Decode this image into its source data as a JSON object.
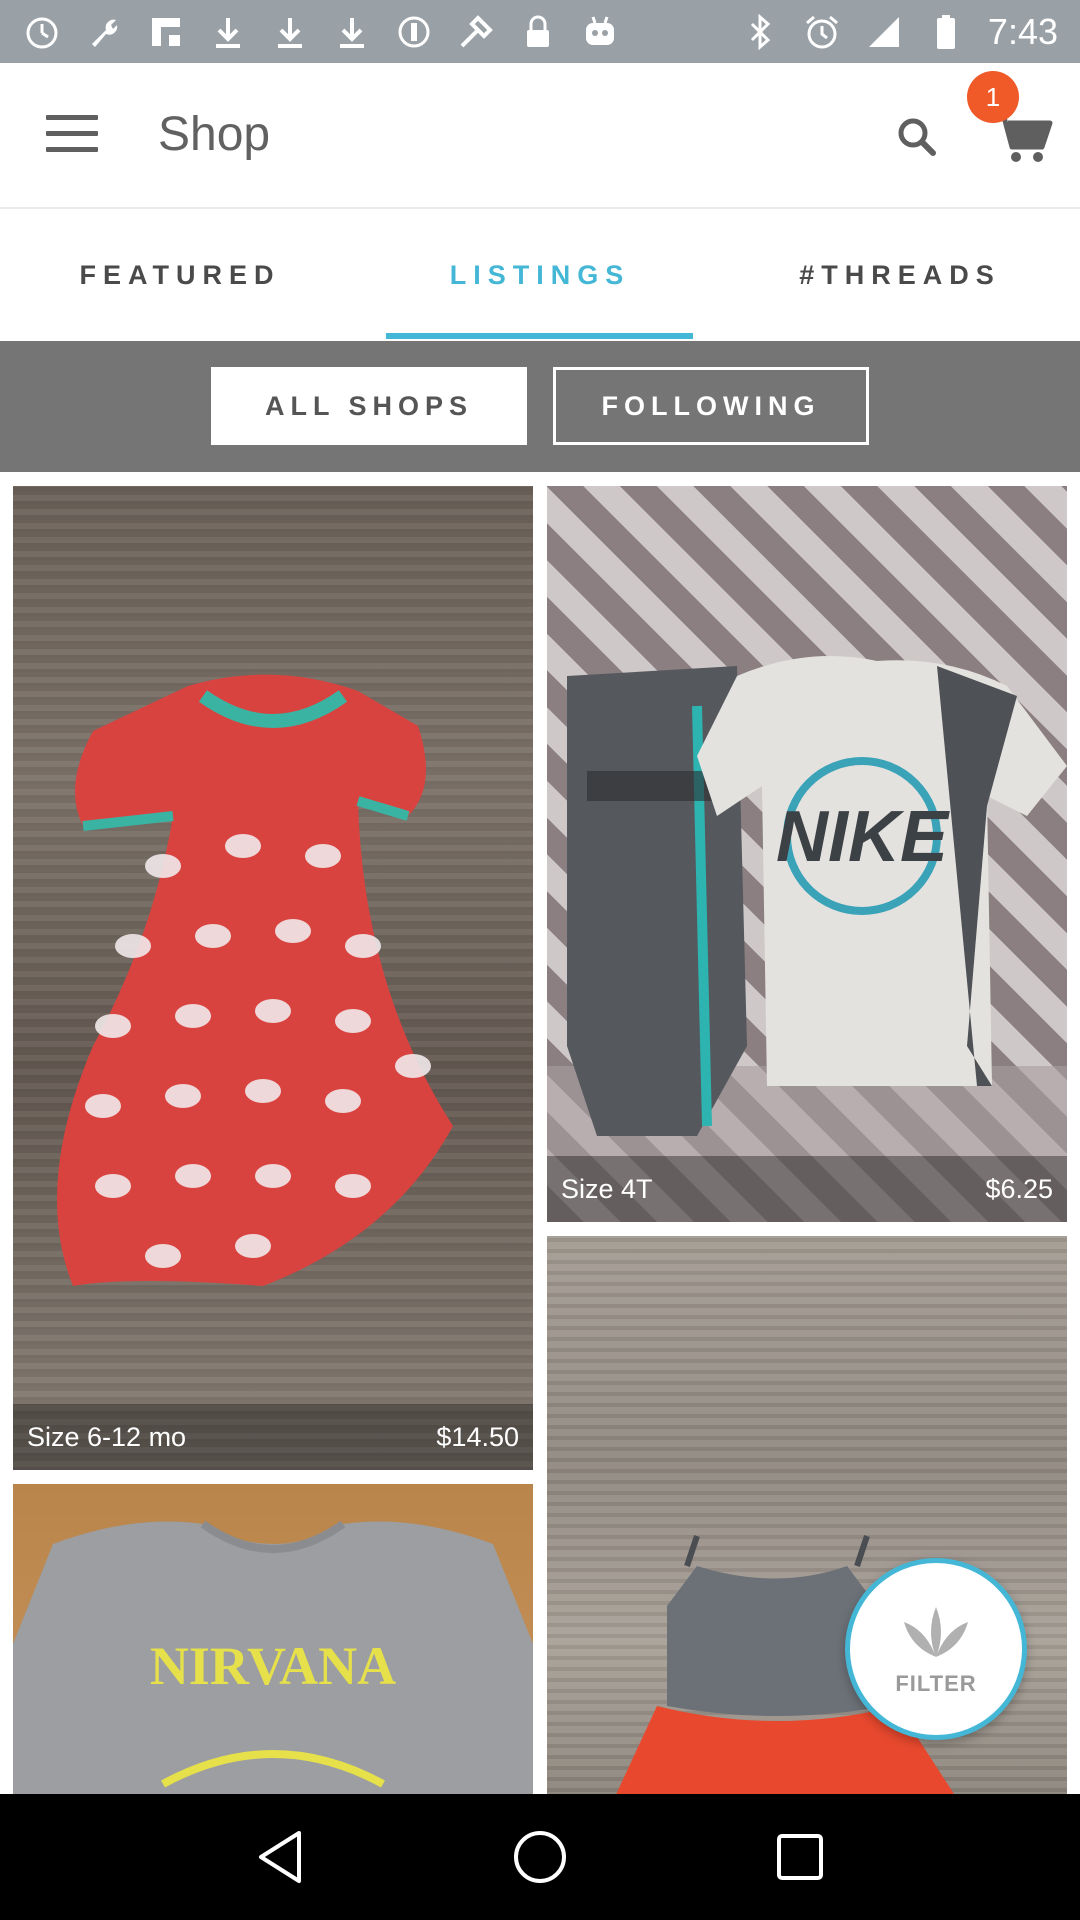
{
  "status_bar": {
    "time": "7:43",
    "left_icons": [
      "timer-icon",
      "wrench-icon",
      "flipboard-icon",
      "download-icon",
      "download-icon",
      "download-icon",
      "disabled-icon",
      "fake-gps-icon",
      "lock-icon",
      "robot-icon"
    ],
    "right_icons": [
      "bluetooth-icon",
      "alarm-icon",
      "signal-icon",
      "battery-icon"
    ]
  },
  "app_bar": {
    "title": "Shop",
    "cart_count": "1"
  },
  "tabs": [
    {
      "label": "FEATURED",
      "active": false
    },
    {
      "label": "LISTINGS",
      "active": true
    },
    {
      "label": "#THREADS",
      "active": false
    }
  ],
  "segments": {
    "all_shops": "ALL SHOPS",
    "following": "FOLLOWING",
    "selected": "ALL SHOPS"
  },
  "listings": [
    {
      "size": "Size 6-12 mo",
      "price": "$14.50",
      "image": "red butterfly print baby dress on wood"
    },
    {
      "size": "Size 4T",
      "price": "$6.25",
      "image": "Nike shirt and shorts on chevron blanket"
    },
    {
      "image": "gray Nirvana onesie"
    },
    {
      "image": "gray and orange baby dress on wood"
    }
  ],
  "fab": {
    "label": "FILTER"
  },
  "colors": {
    "accent": "#45b7d6",
    "badge": "#f05a28",
    "status_bar": "#9aa1a6",
    "segment_bar": "#757575"
  }
}
